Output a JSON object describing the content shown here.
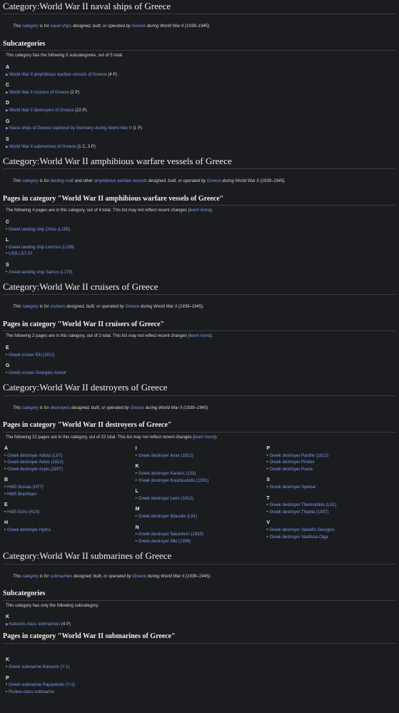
{
  "sections": [
    {
      "title": "Category:World War II naval ships of Greece",
      "desc": {
        "pre": "This ",
        "a": "category",
        "b": " is for ",
        "c": "naval ships",
        "d": " designed, built, or operated by ",
        "e": "Greece",
        "f": " during World War II (1939–1945)."
      },
      "subcats": {
        "heading": "Subcategories",
        "summary": "This category has the following 5 subcategories, out of 5 total.",
        "groups": [
          {
            "letter": "A",
            "items": [
              {
                "name": "World War II amphibious warfare vessels of Greece",
                "count": "(4 P)"
              }
            ]
          },
          {
            "letter": "C",
            "items": [
              {
                "name": "World War II cruisers of Greece",
                "count": "(2 P)"
              }
            ]
          },
          {
            "letter": "D",
            "items": [
              {
                "name": "World War II destroyers of Greece",
                "count": "(22 P)"
              }
            ]
          },
          {
            "letter": "G",
            "items": [
              {
                "name": "Naval ships of Greece captured by Germany during World War II",
                "count": "(1 P)"
              }
            ]
          },
          {
            "letter": "S",
            "items": [
              {
                "name": "World War II submarines of Greece",
                "count": "(1 C, 3 P)"
              }
            ]
          }
        ]
      }
    },
    {
      "title": "Category:World War II amphibious warfare vessels of Greece",
      "desc": {
        "pre": "This ",
        "a": "category",
        "b": " is for ",
        "c": "landing craft",
        "c2": " and other ",
        "c3": "amphibious warfare vessels",
        "d": " designed, built, or operated by ",
        "e": "Greece",
        "f": " during World War II (1939–1945)."
      },
      "pages": {
        "heading": "Pages in category \"World War II amphibious warfare vessels of Greece\"",
        "summary_pre": "The following 4 pages are in this category, out of 4 total. This list may not reflect recent changes (",
        "learn": "learn more",
        "summary_post": ").",
        "groups": [
          {
            "letter": "C",
            "items": [
              "Greek landing ship Chios (L195)"
            ]
          },
          {
            "letter": "L",
            "items": [
              "Greek landing ship Lemnos (L158)",
              "USS LST-37"
            ]
          },
          {
            "letter": "S",
            "items": [
              "Greek landing ship Samos (L179)"
            ]
          }
        ]
      }
    },
    {
      "title": "Category:World War II cruisers of Greece",
      "desc": {
        "pre": "This ",
        "a": "category",
        "b": " is for ",
        "c": "cruisers",
        "d": " designed, built, or operated by ",
        "e": "Greece",
        "f": " during World War II (1939–1945)."
      },
      "pages": {
        "heading": "Pages in category \"World War II cruisers of Greece\"",
        "summary_pre": "The following 2 pages are in this category, out of 2 total. This list may not reflect recent changes (",
        "learn": "learn more",
        "summary_post": ").",
        "groups": [
          {
            "letter": "E",
            "items": [
              "Greek cruiser Elli (1912)"
            ]
          },
          {
            "letter": "G",
            "items": [
              "Greek cruiser Georgios Averof"
            ]
          }
        ]
      }
    },
    {
      "title": "Category:World War II destroyers of Greece",
      "desc": {
        "pre": "This ",
        "a": "category",
        "b": " is for ",
        "c": "destroyers",
        "d": " designed, built, or operated by ",
        "e": "Greece",
        "f": " during World War II (1939–1945)."
      },
      "pages": {
        "heading": "Pages in category \"World War II destroyers of Greece\"",
        "summary_pre": "The following 22 pages are in this category, out of 22 total. This list may not reflect recent changes (",
        "learn": "learn more",
        "summary_post": ").",
        "columns": [
          [
            {
              "letter": "A",
              "items": [
                "Greek destroyer Adrias (L67)",
                "Greek destroyer Aetos (1912)",
                "Greek destroyer Aspis (1907)"
              ]
            },
            {
              "letter": "B",
              "items": [
                "HMS Boreas (H77)",
                "HMS Bramham"
              ]
            },
            {
              "letter": "E",
              "items": [
                "HMS Echo (H23)"
              ]
            },
            {
              "letter": "H",
              "items": [
                "Greek destroyer Hydra"
              ]
            }
          ],
          [
            {
              "letter": "I",
              "items": [
                "Greek destroyer Ierax (1912)"
              ]
            },
            {
              "letter": "K",
              "items": [
                "Greek destroyer Kanaris (L53)",
                "Greek destroyer Kountouriotis (1931)"
              ]
            },
            {
              "letter": "L",
              "items": [
                "Greek destroyer Leon (1912)"
              ]
            },
            {
              "letter": "M",
              "items": [
                "Greek destroyer Miaoulis (L91)"
              ]
            },
            {
              "letter": "N",
              "items": [
                "Greek destroyer Navarinon (1933)",
                "Greek destroyer Niki (1906)"
              ]
            }
          ],
          [
            {
              "letter": "P",
              "items": [
                "Greek destroyer Panthir (1912)",
                "Greek destroyer Pindos",
                "Greek destroyer Psara"
              ]
            },
            {
              "letter": "S",
              "items": [
                "Greek destroyer Spetsai"
              ]
            },
            {
              "letter": "T",
              "items": [
                "Greek destroyer Themistoklis (L51)",
                "Greek destroyer Thyella (1907)"
              ]
            },
            {
              "letter": "V",
              "items": [
                "Greek destroyer Vasilefs Georgios",
                "Greek destroyer Vasilissa Olga"
              ]
            }
          ]
        ]
      }
    },
    {
      "title": "Category:World War II submarines of Greece",
      "desc": {
        "pre": "This ",
        "a": "category",
        "b": " is for ",
        "c": "submarines",
        "d": " designed, built, or operated by ",
        "e": "Greece",
        "f": " during World War II (1939–1945)."
      },
      "subcats": {
        "heading": "Subcategories",
        "summary": "This category has only the following subcategory.",
        "groups": [
          {
            "letter": "K",
            "items": [
              {
                "name": "Katsonis-class submarines",
                "count": "(4 P)"
              }
            ]
          }
        ]
      },
      "pages": {
        "heading": "Pages in category \"World War II submarines of Greece\"",
        "groups": [
          {
            "letter": "K",
            "items": [
              "Greek submarine Katsonis (Y-1)"
            ]
          },
          {
            "letter": "P",
            "items": [
              "Greek submarine Papanikolis (Y-2)",
              "Proteis-class submarine"
            ]
          }
        ]
      }
    }
  ]
}
